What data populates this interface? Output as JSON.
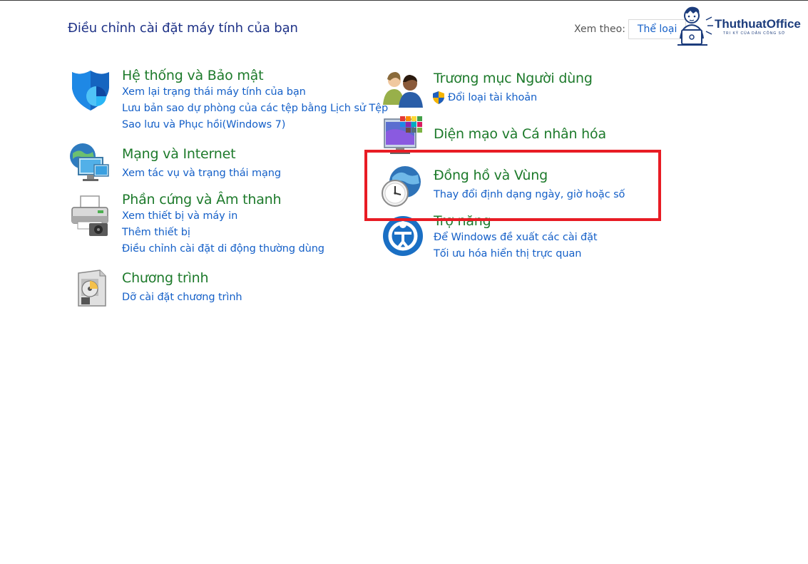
{
  "header": {
    "title": "Điều chỉnh cài đặt máy tính của bạn",
    "view_by_label": "Xem theo:",
    "view_by_value": "Thể loại"
  },
  "watermark": {
    "name": "ThuthuatOffice",
    "tagline": "TRI KỶ CỦA DÂN CÔNG SỞ"
  },
  "categories": [
    {
      "icon": "shield-icon",
      "title": "Hệ thống và Bảo mật",
      "links": [
        "Xem lại trạng thái máy tính của bạn",
        "Lưu bản sao dự phòng của các tệp bằng Lịch sử Tệp",
        "Sao lưu và Phục hồi(Windows 7)"
      ]
    },
    {
      "icon": "network-icon",
      "title": "Mạng và Internet",
      "links": [
        "Xem tác vụ và trạng thái mạng"
      ]
    },
    {
      "icon": "printer-icon",
      "title": "Phần cứng và Âm thanh",
      "links": [
        "Xem thiết bị và máy in",
        "Thêm thiết bị",
        "Điều chỉnh cài đặt di động thường dùng"
      ]
    },
    {
      "icon": "programs-icon",
      "title": "Chương trình",
      "links": [
        "Dỡ cài đặt chương trình"
      ]
    },
    {
      "icon": "users-icon",
      "title": "Trương mục Người dùng",
      "links": [
        "Đổi loại tài khoản"
      ]
    },
    {
      "icon": "personalization-icon",
      "title": "Diện mạo và Cá nhân hóa",
      "links": []
    },
    {
      "icon": "clock-globe-icon",
      "title": "Đồng hồ và Vùng",
      "links": [
        "Thay đổi định dạng ngày, giờ hoặc số"
      ]
    },
    {
      "icon": "ease-of-access-icon",
      "title": "Trợ năng",
      "links": [
        "Để Windows đề xuất các cài đặt",
        "Tối ưu hóa hiển thị trực quan"
      ]
    }
  ],
  "highlight_color": "#e81c24"
}
